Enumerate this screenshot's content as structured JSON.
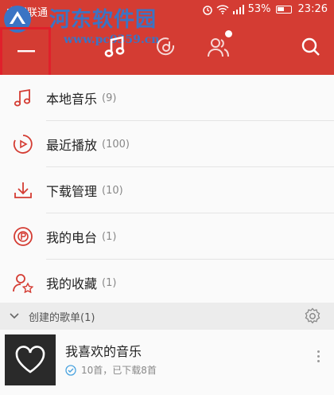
{
  "status_bar": {
    "carrier": "中国联通",
    "battery": "53%",
    "time": "23:26"
  },
  "watermark": {
    "title": "河东软件园",
    "url": "www.pc0359.cn"
  },
  "topnav": {
    "icons": [
      "menu-icon",
      "music-note-icon",
      "netease-logo-icon",
      "friends-icon",
      "search-icon"
    ]
  },
  "menu": [
    {
      "icon": "music-note-icon",
      "label": "本地音乐",
      "count": "(9)"
    },
    {
      "icon": "recent-play-icon",
      "label": "最近播放",
      "count": "(100)"
    },
    {
      "icon": "download-icon",
      "label": "下载管理",
      "count": "(10)"
    },
    {
      "icon": "radio-icon",
      "label": "我的电台",
      "count": "(1)"
    },
    {
      "icon": "collection-icon",
      "label": "我的收藏",
      "count": "(1)"
    }
  ],
  "section": {
    "title": "创建的歌单(1)"
  },
  "playlist": {
    "name": "我喜欢的音乐",
    "meta": "10首，已下载8首"
  },
  "colors": {
    "brand_red": "#d43c33",
    "highlight_border": "#e0202b",
    "watermark_blue": "#3b74c4"
  }
}
